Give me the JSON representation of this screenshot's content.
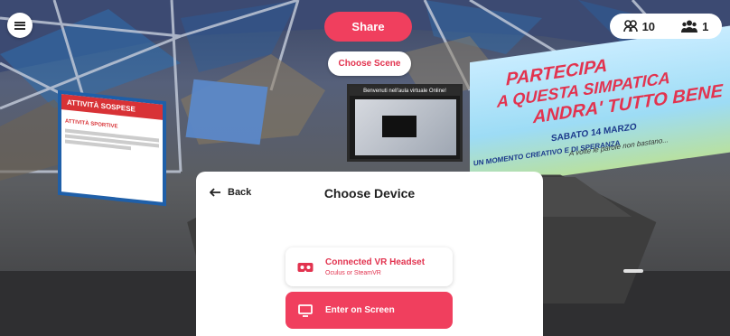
{
  "toolbar": {
    "share_label": "Share",
    "choose_scene_label": "Choose Scene",
    "members_count": "10",
    "present_count": "1",
    "icons": [
      "menu-icon",
      "members-icon",
      "people-icon"
    ]
  },
  "scene": {
    "left_poster": {
      "header": "ATTIVITÀ SOSPESE",
      "subtitle": "ATTIVITÀ SPORTIVE"
    },
    "screen_title": "Benvenuti nell'aula virtuale Online!",
    "right_poster": {
      "line1": "PARTECIPA",
      "line2": "A QUESTA SIMPATICA",
      "line3": "ANDRA' TUTTO BENE",
      "line4": "SABATO 14 MARZO",
      "line5": "UN MOMENTO CREATIVO E DI SPERANZA",
      "line6": "A volte le parole non bastano..."
    }
  },
  "dialog": {
    "back_label": "Back",
    "title": "Choose Device",
    "options": [
      {
        "label": "Connected VR Headset",
        "sublabel": "Oculus or SteamVR",
        "icon": "vr-headset-icon"
      },
      {
        "label": "Enter on Screen",
        "icon": "monitor-icon"
      }
    ]
  },
  "colors": {
    "accent": "#f03f5e",
    "accent_text": "#e2334f",
    "panel": "#ffffff"
  }
}
